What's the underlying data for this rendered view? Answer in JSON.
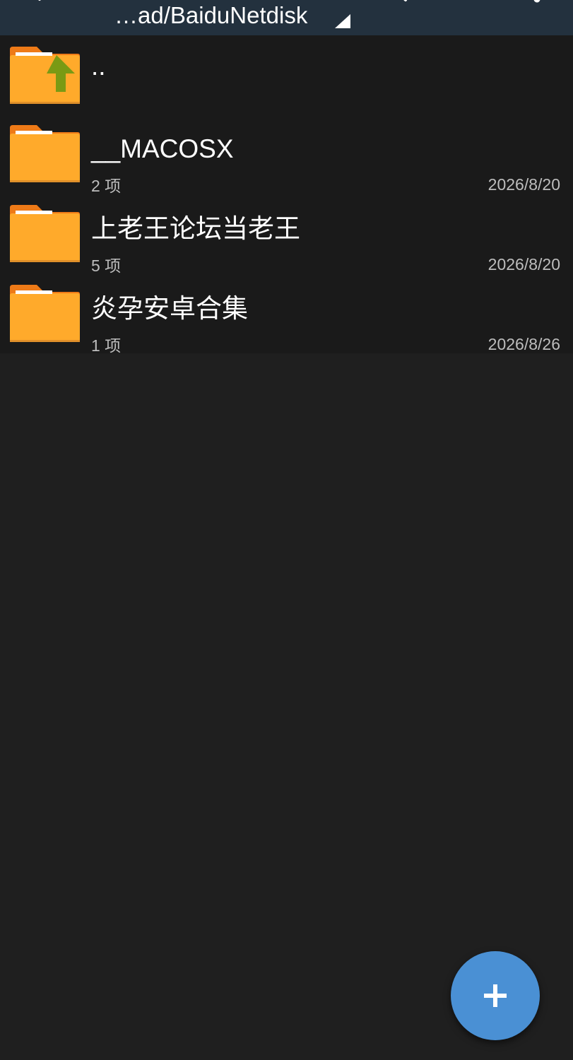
{
  "toolbar": {
    "path": "…ad/BaiduNetdisk",
    "back_icon": "chevron-left-icon",
    "search_icon": "search-icon",
    "more_icon": "more-vert-icon",
    "caret_icon": "dropdown-triangle-icon",
    "background_color": "#23313e"
  },
  "files": {
    "parent": {
      "name": "..",
      "icon": "folder-up-icon"
    },
    "items": [
      {
        "name": "__MACOSX",
        "count": "2 项",
        "date": "2026/8/20",
        "icon": "folder-icon"
      },
      {
        "name": "上老王论坛当老王",
        "count": "5 项",
        "date": "2026/8/20",
        "icon": "folder-icon"
      },
      {
        "name": "炎孕安卓合集",
        "count": "1 项",
        "date": "2026/8/26",
        "icon": "folder-icon"
      }
    ]
  },
  "fab": {
    "icon": "plus-icon",
    "color": "#4a90d4"
  },
  "colors": {
    "background": "#1f1f1f",
    "list_background": "#1a1a1a",
    "folder": "#ffaa2b",
    "folder_tab": "#ee7a17",
    "up_arrow": "#7a9a14"
  }
}
